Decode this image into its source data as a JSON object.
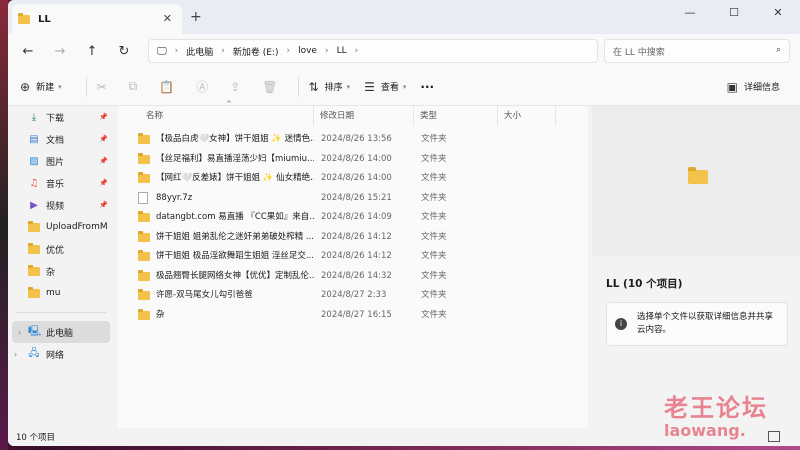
{
  "window": {
    "tab_title": "LL",
    "tab_close": "✕",
    "tab_add": "+",
    "controls": [
      "—",
      "☐",
      "✕"
    ]
  },
  "nav": {
    "back": "←",
    "forward": "→",
    "up": "↑",
    "refresh": "↻",
    "breadcrumb": [
      "此电脑",
      "新加卷 (E:)",
      "love",
      "LL"
    ],
    "search_placeholder": "在 LL 中搜索"
  },
  "toolbar": {
    "new_label": "新建",
    "sort_label": "排序",
    "view_label": "查看",
    "more_label": "···",
    "details_label": "详细信息"
  },
  "sidebar": {
    "pinned": [
      {
        "label": "下载",
        "icon": "download-icon"
      },
      {
        "label": "文档",
        "icon": "document-icon"
      },
      {
        "label": "图片",
        "icon": "picture-icon"
      },
      {
        "label": "音乐",
        "icon": "music-icon"
      },
      {
        "label": "视频",
        "icon": "video-icon"
      }
    ],
    "folders": [
      "UploadFromM",
      "优优",
      "杂",
      "mu"
    ],
    "this_pc": "此电脑",
    "network": "网络"
  },
  "columns": {
    "name": "名称",
    "date": "修改日期",
    "type": "类型",
    "size": "大小"
  },
  "files": [
    {
      "name": "【极品白虎🤍女神】饼干姐姐 ✨ 迷情色...",
      "date": "2024/8/26 13:56",
      "type": "文件夹",
      "kind": "folder"
    },
    {
      "name": "【丝足福利】易直播淫荡少妇【miumiu...",
      "date": "2024/8/26 14:00",
      "type": "文件夹",
      "kind": "folder"
    },
    {
      "name": "【网红🤍反差婊】饼干姐姐 ✨ 仙女精绝...",
      "date": "2024/8/26 14:00",
      "type": "文件夹",
      "kind": "folder"
    },
    {
      "name": "88yyr.7z",
      "date": "2024/8/26 15:21",
      "type": "文件夹",
      "kind": "file"
    },
    {
      "name": "datangbt.com 易直播 『CC果如』来自...",
      "date": "2024/8/26 14:09",
      "type": "文件夹",
      "kind": "folder"
    },
    {
      "name": "饼干姐姐 姐弟乱伦之迷奸弟弟破处榨精 ...",
      "date": "2024/8/26 14:12",
      "type": "文件夹",
      "kind": "folder"
    },
    {
      "name": "饼干姐姐 极品淫欲舞蹈生姐姐 淫丝足交...",
      "date": "2024/8/26 14:12",
      "type": "文件夹",
      "kind": "folder"
    },
    {
      "name": "极品翘臀长腿网络女神【优优】定制乱伦...",
      "date": "2024/8/26 14:32",
      "type": "文件夹",
      "kind": "folder"
    },
    {
      "name": "许愿-双马尾女儿勾引爸爸",
      "date": "2024/8/27 2:33",
      "type": "文件夹",
      "kind": "folder"
    },
    {
      "name": "杂",
      "date": "2024/8/27 16:15",
      "type": "文件夹",
      "kind": "folder"
    }
  ],
  "details": {
    "title": "LL (10 个项目)",
    "info": "选择单个文件以获取详细信息并共享云内容。"
  },
  "status": {
    "count": "10 个项目"
  },
  "watermark": {
    "line1": "老王论坛",
    "line2": "laowang."
  }
}
